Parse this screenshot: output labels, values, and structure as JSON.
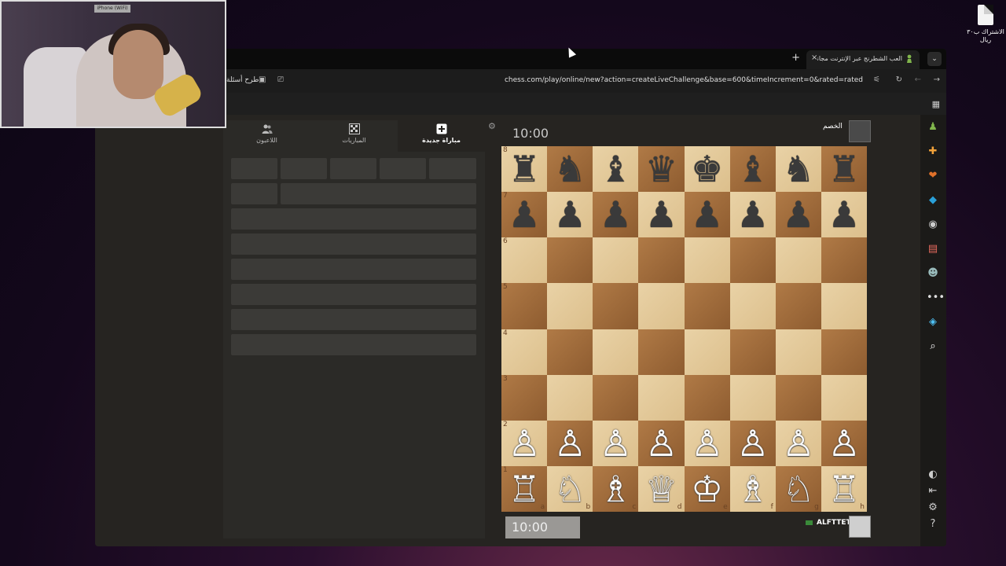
{
  "desktop": {
    "file_label": "الاشتراك ب٣٠ ريال"
  },
  "webcam": {
    "tag": "iPhone (WiFi)"
  },
  "browser": {
    "tab_title": "العب الشطرنج عبر الإنترنت مجاناً",
    "url": "chess.com/play/online/new?action=createLiveChallenge&base=600&timeIncrement=0&rated=rated",
    "ask_label": "طرح أسئلة",
    "new_tab_symbol": "+",
    "close_symbol": "×"
  },
  "panel": {
    "tabs": [
      {
        "label": "مباراة جديدة",
        "icon": "plus-square-icon",
        "active": true
      },
      {
        "label": "المباريات",
        "icon": "board-icon",
        "active": false
      },
      {
        "label": "اللاعبون",
        "icon": "players-icon",
        "active": false
      }
    ]
  },
  "game": {
    "opponent_clock": "10:00",
    "opponent_name": "الخصم",
    "player_clock": "10:00",
    "player_name": "ALFTTET",
    "files": [
      "a",
      "b",
      "c",
      "d",
      "e",
      "f",
      "g",
      "h"
    ],
    "ranks": [
      "8",
      "7",
      "6",
      "5",
      "4",
      "3",
      "2",
      "1"
    ],
    "position": [
      [
        "♜",
        "♞",
        "♝",
        "♛",
        "♚",
        "♝",
        "♞",
        "♜"
      ],
      [
        "♟",
        "♟",
        "♟",
        "♟",
        "♟",
        "♟",
        "♟",
        "♟"
      ],
      [
        "",
        "",
        "",
        "",
        "",
        "",
        "",
        ""
      ],
      [
        "",
        "",
        "",
        "",
        "",
        "",
        "",
        ""
      ],
      [
        "",
        "",
        "",
        "",
        "",
        "",
        "",
        ""
      ],
      [
        "",
        "",
        "",
        "",
        "",
        "",
        "",
        ""
      ],
      [
        "♙",
        "♙",
        "♙",
        "♙",
        "♙",
        "♙",
        "♙",
        "♙"
      ],
      [
        "♖",
        "♘",
        "♗",
        "♕",
        "♔",
        "♗",
        "♘",
        "♖"
      ]
    ]
  },
  "rail": {
    "icons": [
      "pawn-icon",
      "puzzle-icon",
      "lesson-icon",
      "learn-icon",
      "watch-icon",
      "news-icon",
      "social-icon",
      "more-icon",
      "diamond-icon",
      "search-icon"
    ],
    "bottom_icons": [
      "theme-icon",
      "collapse-icon",
      "settings-icon",
      "help-icon"
    ],
    "colors": {
      "pawn": "#81b64c",
      "puzzle": "#f2a23a",
      "lesson": "#e0712a",
      "learn": "#2aa0d8",
      "diamond": "#4fc3f7"
    }
  }
}
